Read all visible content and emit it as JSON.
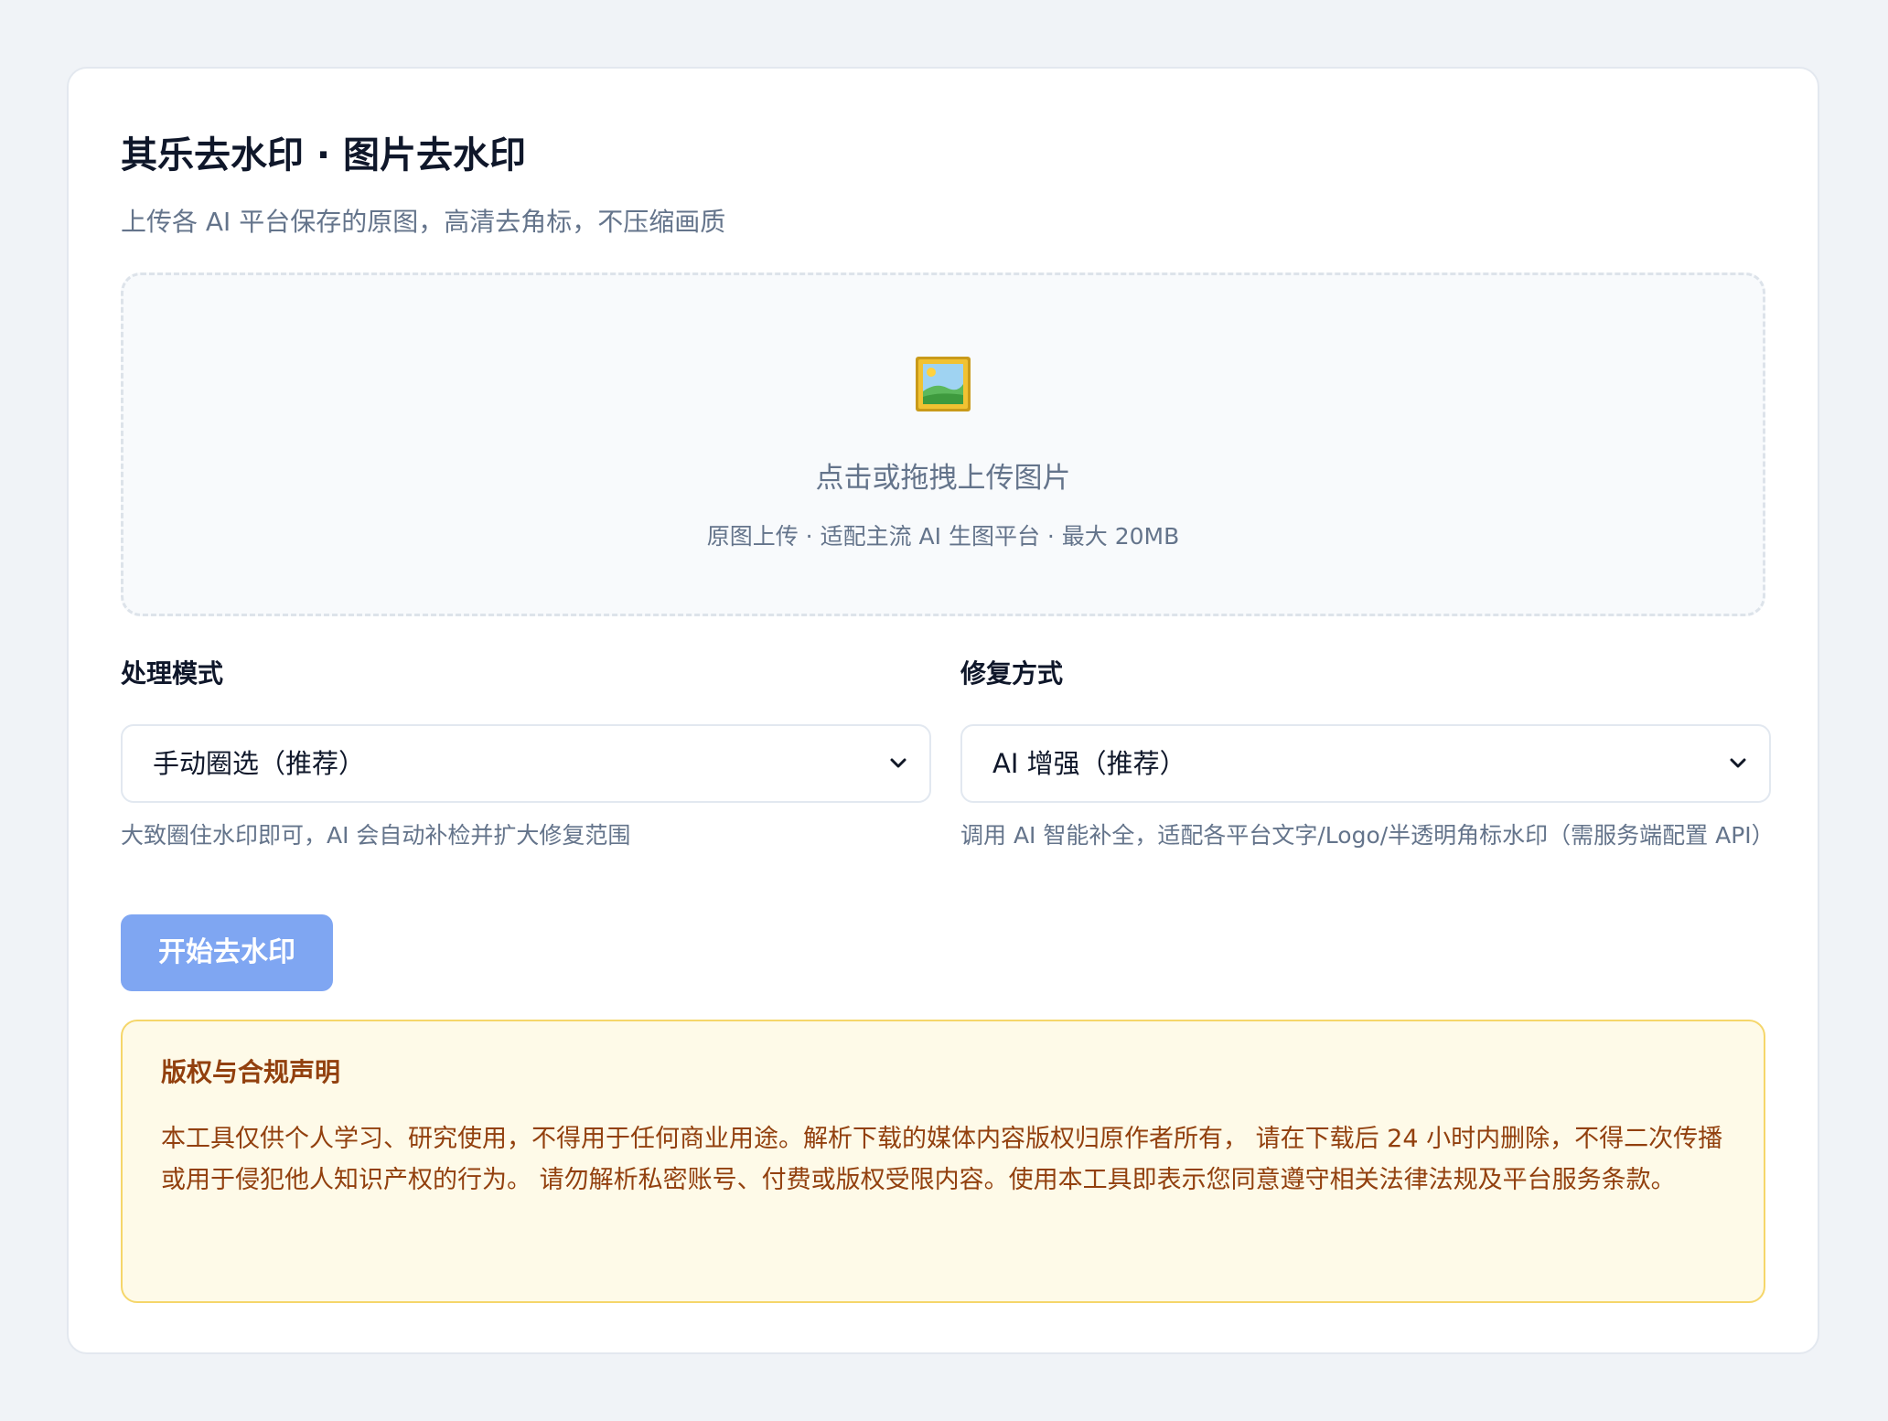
{
  "header": {
    "title": "其乐去水印 · 图片去水印",
    "subtitle": "上传各 AI 平台保存的原图，高清去角标，不压缩画质"
  },
  "upload": {
    "icon": "framed-picture-icon",
    "title": "点击或拖拽上传图片",
    "hint": "原图上传 · 适配主流 AI 生图平台 · 最大 20MB"
  },
  "mode": {
    "label": "处理模式",
    "selected": "手动圈选（推荐）",
    "hint": "大致圈住水印即可，AI 会自动补检并扩大修复范围"
  },
  "repair": {
    "label": "修复方式",
    "selected": "AI 增强（推荐）",
    "hint": "调用 AI 智能补全，适配各平台文字/Logo/半透明角标水印（需服务端配置 API）"
  },
  "actions": {
    "start_label": "开始去水印"
  },
  "notice": {
    "title": "版权与合规声明",
    "body": "本工具仅供个人学习、研究使用，不得用于任何商业用途。解析下载的媒体内容版权归原作者所有， 请在下载后 24 小时内删除，不得二次传播或用于侵犯他人知识产权的行为。 请勿解析私密账号、付费或版权受限内容。使用本工具即表示您同意遵守相关法律法规及平台服务条款。"
  },
  "colors": {
    "accent_button": "#7fa6f2",
    "notice_bg": "#fefae8",
    "notice_border": "#f5d66a",
    "notice_text": "#92400e",
    "muted_text": "#64748b"
  }
}
